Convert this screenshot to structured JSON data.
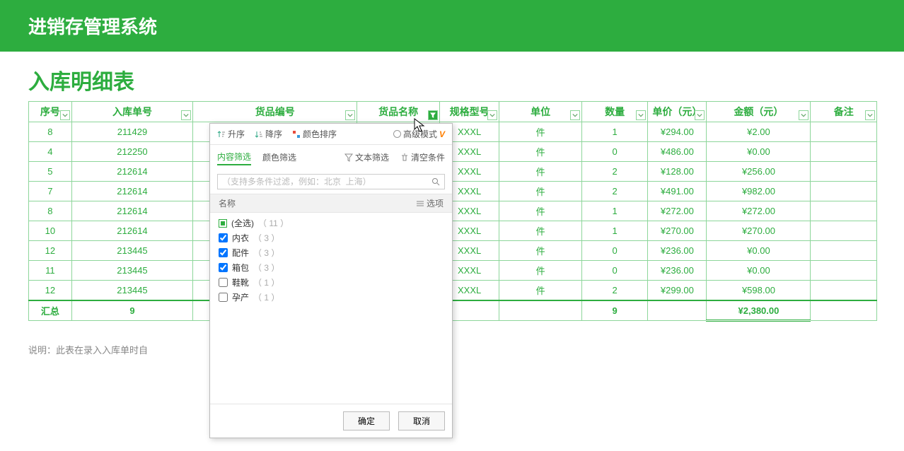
{
  "banner": {
    "title": "进销存管理系统"
  },
  "subtitle": "入库明细表",
  "columns": {
    "seq": "序号",
    "orderNo": "入库单号",
    "goodsNo": "货品编号",
    "goodsName": "货品名称",
    "spec": "规格型号",
    "unit": "单位",
    "qty": "数量",
    "price": "单价（元）",
    "amount": "金额（元）",
    "remark": "备注"
  },
  "rows": [
    {
      "seq": "8",
      "orderNo": "211429",
      "spec": "XXXL",
      "unit": "件",
      "qty": "1",
      "price": "¥294.00",
      "amount": "¥2.00",
      "remark": ""
    },
    {
      "seq": "4",
      "orderNo": "212250",
      "spec": "XXXL",
      "unit": "件",
      "qty": "0",
      "price": "¥486.00",
      "amount": "¥0.00",
      "remark": ""
    },
    {
      "seq": "5",
      "orderNo": "212614",
      "spec": "XXXL",
      "unit": "件",
      "qty": "2",
      "price": "¥128.00",
      "amount": "¥256.00",
      "remark": ""
    },
    {
      "seq": "7",
      "orderNo": "212614",
      "spec": "XXXL",
      "unit": "件",
      "qty": "2",
      "price": "¥491.00",
      "amount": "¥982.00",
      "remark": ""
    },
    {
      "seq": "8",
      "orderNo": "212614",
      "spec": "XXXL",
      "unit": "件",
      "qty": "1",
      "price": "¥272.00",
      "amount": "¥272.00",
      "remark": ""
    },
    {
      "seq": "10",
      "orderNo": "212614",
      "spec": "XXXL",
      "unit": "件",
      "qty": "1",
      "price": "¥270.00",
      "amount": "¥270.00",
      "remark": ""
    },
    {
      "seq": "12",
      "orderNo": "213445",
      "spec": "XXXL",
      "unit": "件",
      "qty": "0",
      "price": "¥236.00",
      "amount": "¥0.00",
      "remark": ""
    },
    {
      "seq": "11",
      "orderNo": "213445",
      "spec": "XXXL",
      "unit": "件",
      "qty": "0",
      "price": "¥236.00",
      "amount": "¥0.00",
      "remark": ""
    },
    {
      "seq": "12",
      "orderNo": "213445",
      "spec": "XXXL",
      "unit": "件",
      "qty": "2",
      "price": "¥299.00",
      "amount": "¥598.00",
      "remark": ""
    }
  ],
  "summary": {
    "label": "汇总",
    "orderCount": "9",
    "qty": "9",
    "amount": "¥2,380.00"
  },
  "footnote": "说明：此表在录入入库单时自",
  "popup": {
    "sortAsc": "升序",
    "sortDesc": "降序",
    "colorSort": "颜色排序",
    "advMode": "高级模式",
    "tabContent": "内容筛选",
    "tabColor": "颜色筛选",
    "textFilter": "文本筛选",
    "clearCond": "清空条件",
    "searchPlaceholder": "（支持多条件过滤，例如：北京  上海）",
    "listHeadName": "名称",
    "listHeadOptions": "选项",
    "selectAllLabel": "(全选)",
    "selectAllCount": "（ 11 ）",
    "items": [
      {
        "label": "内衣",
        "count": "（ 3 ）",
        "checked": true
      },
      {
        "label": "配件",
        "count": "（ 3 ）",
        "checked": true
      },
      {
        "label": "箱包",
        "count": "（ 3 ）",
        "checked": true
      },
      {
        "label": "鞋靴",
        "count": "（ 1 ）",
        "checked": false
      },
      {
        "label": "孕产",
        "count": "（ 1 ）",
        "checked": false
      }
    ],
    "ok": "确定",
    "cancel": "取消"
  }
}
